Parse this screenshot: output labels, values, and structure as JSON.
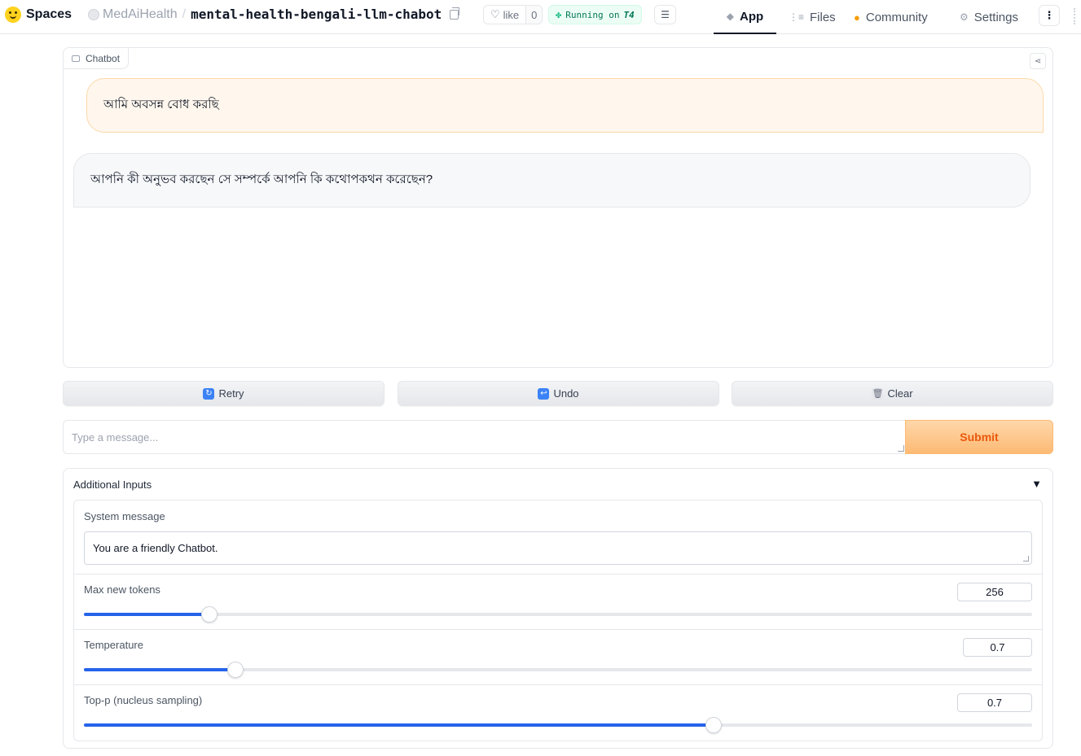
{
  "header": {
    "brand": "Spaces",
    "owner": "MedAiHealth",
    "separator": "/",
    "repo": "mental-health-bengali-llm-chabot",
    "like_label": "like",
    "like_count": "0",
    "status_prefix": "Running on",
    "status_hardware": "T4",
    "tabs": [
      {
        "label": "App",
        "icon": "cube-icon",
        "active": true
      },
      {
        "label": "Files",
        "icon": "files-icon"
      },
      {
        "label": "Community",
        "icon": "community-icon"
      },
      {
        "label": "Settings",
        "icon": "gear-icon"
      }
    ]
  },
  "chatbot": {
    "label": "Chatbot",
    "messages": [
      {
        "role": "user",
        "text": "আমি অবসন্ন বোধ করছি"
      },
      {
        "role": "assistant",
        "text": "আপনি কী অনুভব করছেন সে সম্পর্কে আপনি কি কথোপকথন করেছেন?"
      }
    ]
  },
  "actions": {
    "retry": "Retry",
    "undo": "Undo",
    "clear": "Clear"
  },
  "message_input": {
    "placeholder": "Type a message...",
    "value": "",
    "submit": "Submit"
  },
  "additional_inputs": {
    "title": "Additional Inputs",
    "toggle": "▼",
    "system_message": {
      "label": "System message",
      "value": "You are a friendly Chatbot."
    },
    "max_new_tokens": {
      "label": "Max new tokens",
      "value": "256",
      "fraction": 0.132
    },
    "temperature": {
      "label": "Temperature",
      "value": "0.7",
      "fraction": 0.16
    },
    "top_p": {
      "label": "Top-p (nucleus sampling)",
      "value": "0.7",
      "fraction": 0.664
    }
  },
  "colors": {
    "accent_orange": "#ea580c",
    "slider_blue": "#2563eb",
    "running_green": "#047857"
  }
}
